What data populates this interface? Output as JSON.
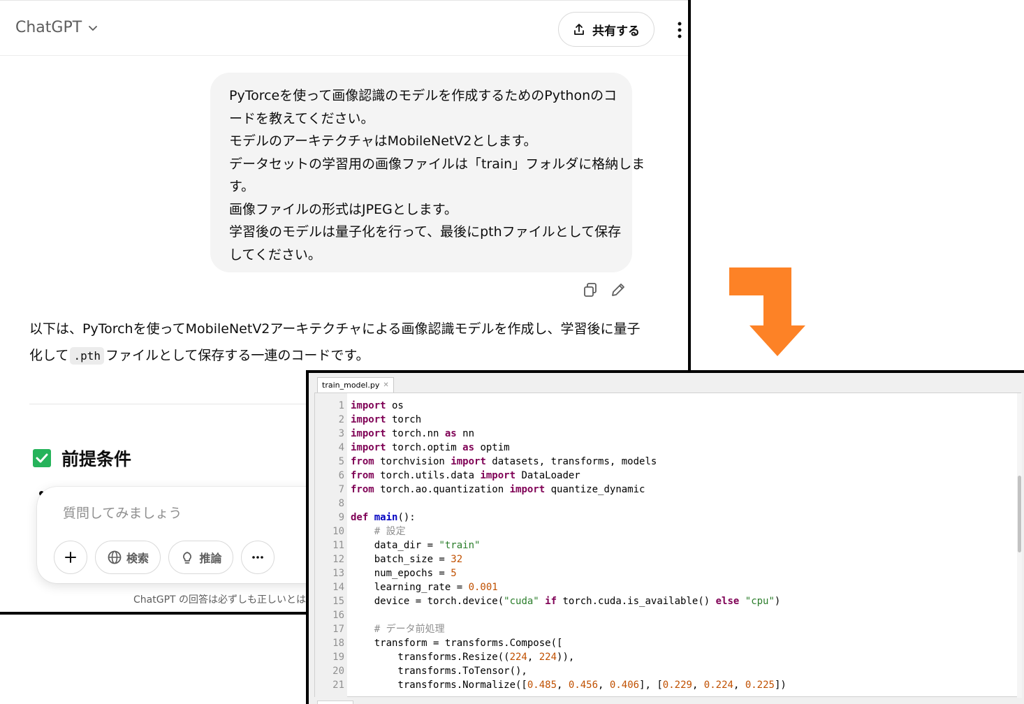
{
  "chat": {
    "app_title": "ChatGPT",
    "share_label": "共有する",
    "user_message_lines": [
      "PyTorceを使って画像認識のモデルを作成するためのPythonのコ",
      "ードを教えてください。",
      "モデルのアーキテクチャはMobileNetV2とします。",
      "データセットの学習用の画像ファイルは「train」フォルダに格納しま",
      "す。",
      "画像ファイルの形式はJPEGとします。",
      "学習後のモデルは量子化を行って、最後にpthファイルとして保存",
      "してください。"
    ],
    "assistant_line1": "以下は、PyTorchを使ってMobileNetV2アーキテクチャによる画像認識モデルを作成し、学習後に量子",
    "assistant_line2_pre": "化して",
    "assistant_code": ".pth",
    "assistant_line2_post": "ファイルとして保存する一連のコードです。",
    "section_heading": "前提条件",
    "composer": {
      "placeholder": "質問してみましょう",
      "search_label": "検索",
      "reason_label": "推論"
    },
    "disclaimer": "ChatGPT の回答は必ずしも正しいとは限りません。"
  },
  "editor": {
    "tab_name": "train_model.py",
    "code_lines": [
      [
        {
          "t": "import",
          "c": "kw"
        },
        {
          "t": " os"
        }
      ],
      [
        {
          "t": "import",
          "c": "kw"
        },
        {
          "t": " torch"
        }
      ],
      [
        {
          "t": "import",
          "c": "kw"
        },
        {
          "t": " torch.nn "
        },
        {
          "t": "as",
          "c": "kw"
        },
        {
          "t": " nn"
        }
      ],
      [
        {
          "t": "import",
          "c": "kw"
        },
        {
          "t": " torch.optim "
        },
        {
          "t": "as",
          "c": "kw"
        },
        {
          "t": " optim"
        }
      ],
      [
        {
          "t": "from",
          "c": "kw"
        },
        {
          "t": " torchvision "
        },
        {
          "t": "import",
          "c": "kw"
        },
        {
          "t": " datasets, transforms, models"
        }
      ],
      [
        {
          "t": "from",
          "c": "kw"
        },
        {
          "t": " torch.utils.data "
        },
        {
          "t": "import",
          "c": "kw"
        },
        {
          "t": " DataLoader"
        }
      ],
      [
        {
          "t": "from",
          "c": "kw"
        },
        {
          "t": " torch.ao.quantization "
        },
        {
          "t": "import",
          "c": "kw"
        },
        {
          "t": " quantize_dynamic"
        }
      ],
      [],
      [
        {
          "t": "def",
          "c": "kw"
        },
        {
          "t": " "
        },
        {
          "t": "main",
          "c": "fn"
        },
        {
          "t": "():"
        }
      ],
      [
        {
          "t": "    "
        },
        {
          "t": "# 設定",
          "c": "cmt"
        }
      ],
      [
        {
          "t": "    data_dir = "
        },
        {
          "t": "\"train\"",
          "c": "str"
        }
      ],
      [
        {
          "t": "    batch_size = "
        },
        {
          "t": "32",
          "c": "num"
        }
      ],
      [
        {
          "t": "    num_epochs = "
        },
        {
          "t": "5",
          "c": "num"
        }
      ],
      [
        {
          "t": "    learning_rate = "
        },
        {
          "t": "0.001",
          "c": "num"
        }
      ],
      [
        {
          "t": "    device = torch.device("
        },
        {
          "t": "\"cuda\"",
          "c": "str"
        },
        {
          "t": " "
        },
        {
          "t": "if",
          "c": "kw"
        },
        {
          "t": " torch.cuda.is_available() "
        },
        {
          "t": "else",
          "c": "kw"
        },
        {
          "t": " "
        },
        {
          "t": "\"cpu\"",
          "c": "str"
        },
        {
          "t": ")"
        }
      ],
      [],
      [
        {
          "t": "    "
        },
        {
          "t": "# データ前処理",
          "c": "cmt"
        }
      ],
      [
        {
          "t": "    transform = transforms.Compose(["
        }
      ],
      [
        {
          "t": "        transforms.Resize(("
        },
        {
          "t": "224",
          "c": "num"
        },
        {
          "t": ", "
        },
        {
          "t": "224",
          "c": "num"
        },
        {
          "t": ")),"
        }
      ],
      [
        {
          "t": "        transforms.ToTensor(),"
        }
      ],
      [
        {
          "t": "        transforms.Normalize(["
        },
        {
          "t": "0.485",
          "c": "num"
        },
        {
          "t": ", "
        },
        {
          "t": "0.456",
          "c": "num"
        },
        {
          "t": ", "
        },
        {
          "t": "0.406",
          "c": "num"
        },
        {
          "t": "], ["
        },
        {
          "t": "0.229",
          "c": "num"
        },
        {
          "t": ", "
        },
        {
          "t": "0.224",
          "c": "num"
        },
        {
          "t": ", "
        },
        {
          "t": "0.225",
          "c": "num"
        },
        {
          "t": "])"
        }
      ]
    ]
  },
  "colors": {
    "arrow": "#fd8226",
    "check": "#25b35a",
    "bubble": "#f4f4f4"
  }
}
